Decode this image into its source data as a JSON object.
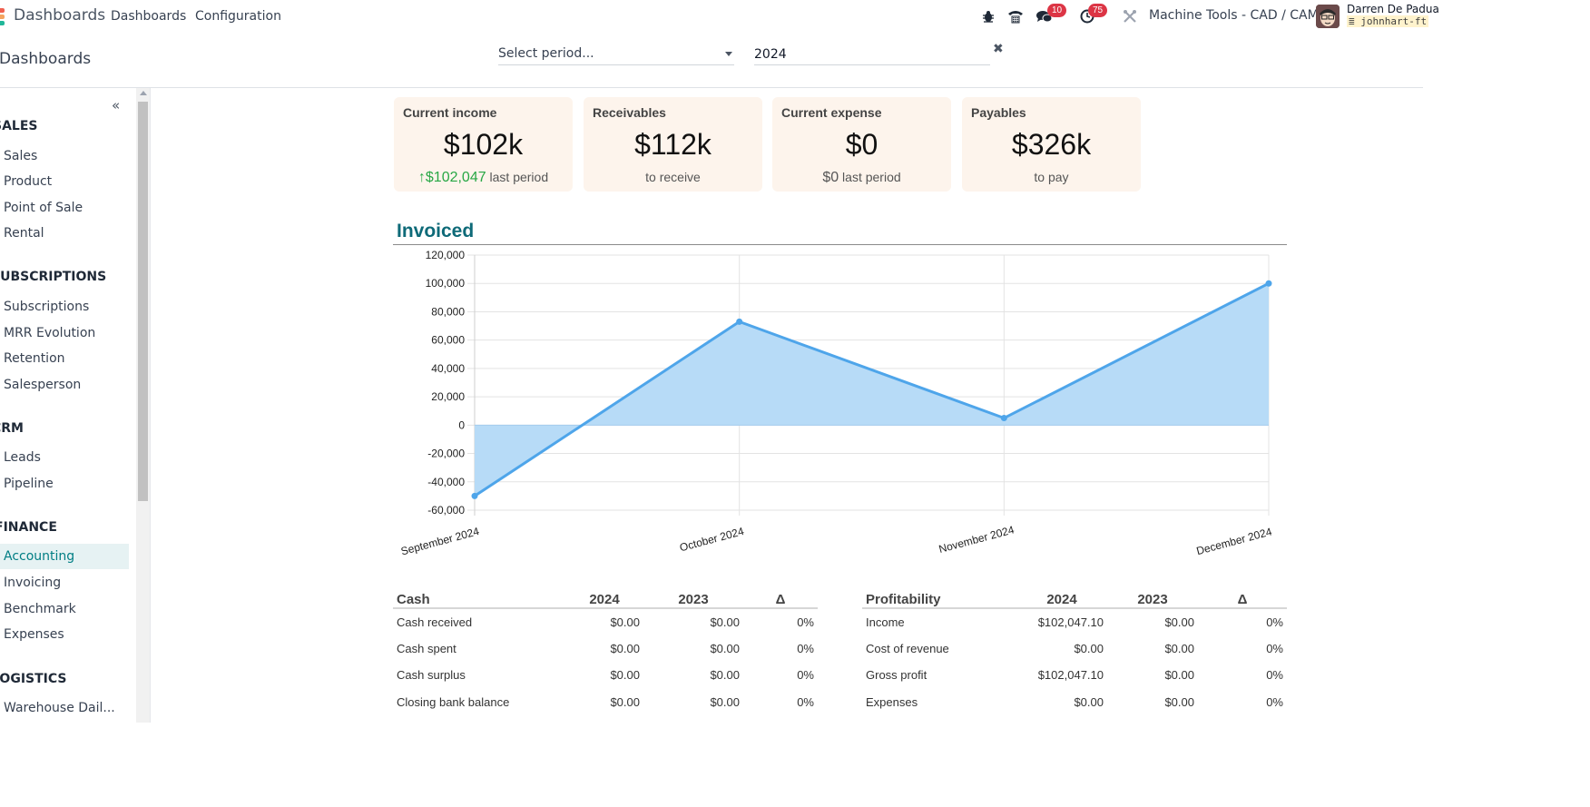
{
  "navbar": {
    "app_name": "Dashboards",
    "menu": [
      "Dashboards",
      "Configuration"
    ],
    "icons": {
      "debug": "bug-icon",
      "phone": "phone-icon",
      "messages": "chat-icon",
      "activities": "clock-icon",
      "settings": "tools-icon"
    },
    "messages_count": "10",
    "activities_count": "75",
    "company": "Machine Tools - CAD / CAM",
    "user_name": "Darren De Padua",
    "database": "johnhart-ft"
  },
  "control_panel": {
    "title": "Dashboards",
    "period_placeholder": "Select period...",
    "year_value": "2024",
    "clear_icon": "✖"
  },
  "sidebar": {
    "collapse_icon": "«",
    "sections": [
      {
        "header": "SALES",
        "items": [
          "Sales",
          "Product",
          "Point of Sale",
          "Rental"
        ]
      },
      {
        "header": "SUBSCRIPTIONS",
        "items": [
          "Subscriptions",
          "MRR Evolution",
          "Retention",
          "Salesperson"
        ]
      },
      {
        "header": "CRM",
        "items": [
          "Leads",
          "Pipeline"
        ]
      },
      {
        "header": "FINANCE",
        "items": [
          "Accounting",
          "Invoicing",
          "Benchmark",
          "Expenses"
        ]
      },
      {
        "header": "LOGISTICS",
        "items": [
          "Warehouse Dail..."
        ]
      }
    ],
    "active_item": "Accounting"
  },
  "kpis": [
    {
      "title": "Current income",
      "value": "$102k",
      "delta": "↑$102,047",
      "sub": "last period"
    },
    {
      "title": "Receivables",
      "value": "$112k",
      "sub": "to receive"
    },
    {
      "title": "Current expense",
      "value": "$0",
      "delta": "$0",
      "sub": "last period"
    },
    {
      "title": "Payables",
      "value": "$326k",
      "sub": "to pay"
    }
  ],
  "colors": {
    "accent": "#017e84",
    "section_title": "#0e6a78",
    "chart_line": "#4ea5ea",
    "chart_fill": "#b7dbf7",
    "kpi_bg": "#fdf4ec",
    "positive": "#28a745",
    "badge": "#dc3545"
  },
  "chart_data": {
    "type": "area",
    "title": "Invoiced",
    "categories": [
      "September 2024",
      "October 2024",
      "November 2024",
      "December 2024"
    ],
    "series": [
      {
        "name": "Invoiced",
        "values": [
          -50000,
          73000,
          5000,
          100000
        ]
      }
    ],
    "xlabel": "",
    "ylabel": "",
    "ylim": [
      -60000,
      120000
    ],
    "yticks": [
      120000,
      100000,
      80000,
      60000,
      40000,
      20000,
      0,
      -20000,
      -40000,
      -60000
    ],
    "ytick_labels": [
      "120,000",
      "100,000",
      "80,000",
      "60,000",
      "40,000",
      "20,000",
      "0",
      "-20,000",
      "-40,000",
      "-60,000"
    ],
    "grid": true,
    "legend": "none"
  },
  "tables": {
    "cash": {
      "headers": [
        "Cash",
        "2024",
        "2023",
        "Δ"
      ],
      "rows": [
        [
          "Cash received",
          "$0.00",
          "$0.00",
          "0%"
        ],
        [
          "Cash spent",
          "$0.00",
          "$0.00",
          "0%"
        ],
        [
          "Cash surplus",
          "$0.00",
          "$0.00",
          "0%"
        ],
        [
          "Closing bank balance",
          "$0.00",
          "$0.00",
          "0%"
        ]
      ]
    },
    "profitability": {
      "headers": [
        "Profitability",
        "2024",
        "2023",
        "Δ"
      ],
      "rows": [
        [
          "Income",
          "$102,047.10",
          "$0.00",
          "0%"
        ],
        [
          "Cost of revenue",
          "$0.00",
          "$0.00",
          "0%"
        ],
        [
          "Gross profit",
          "$102,047.10",
          "$0.00",
          "0%"
        ],
        [
          "Expenses",
          "$0.00",
          "$0.00",
          "0%"
        ]
      ]
    }
  }
}
